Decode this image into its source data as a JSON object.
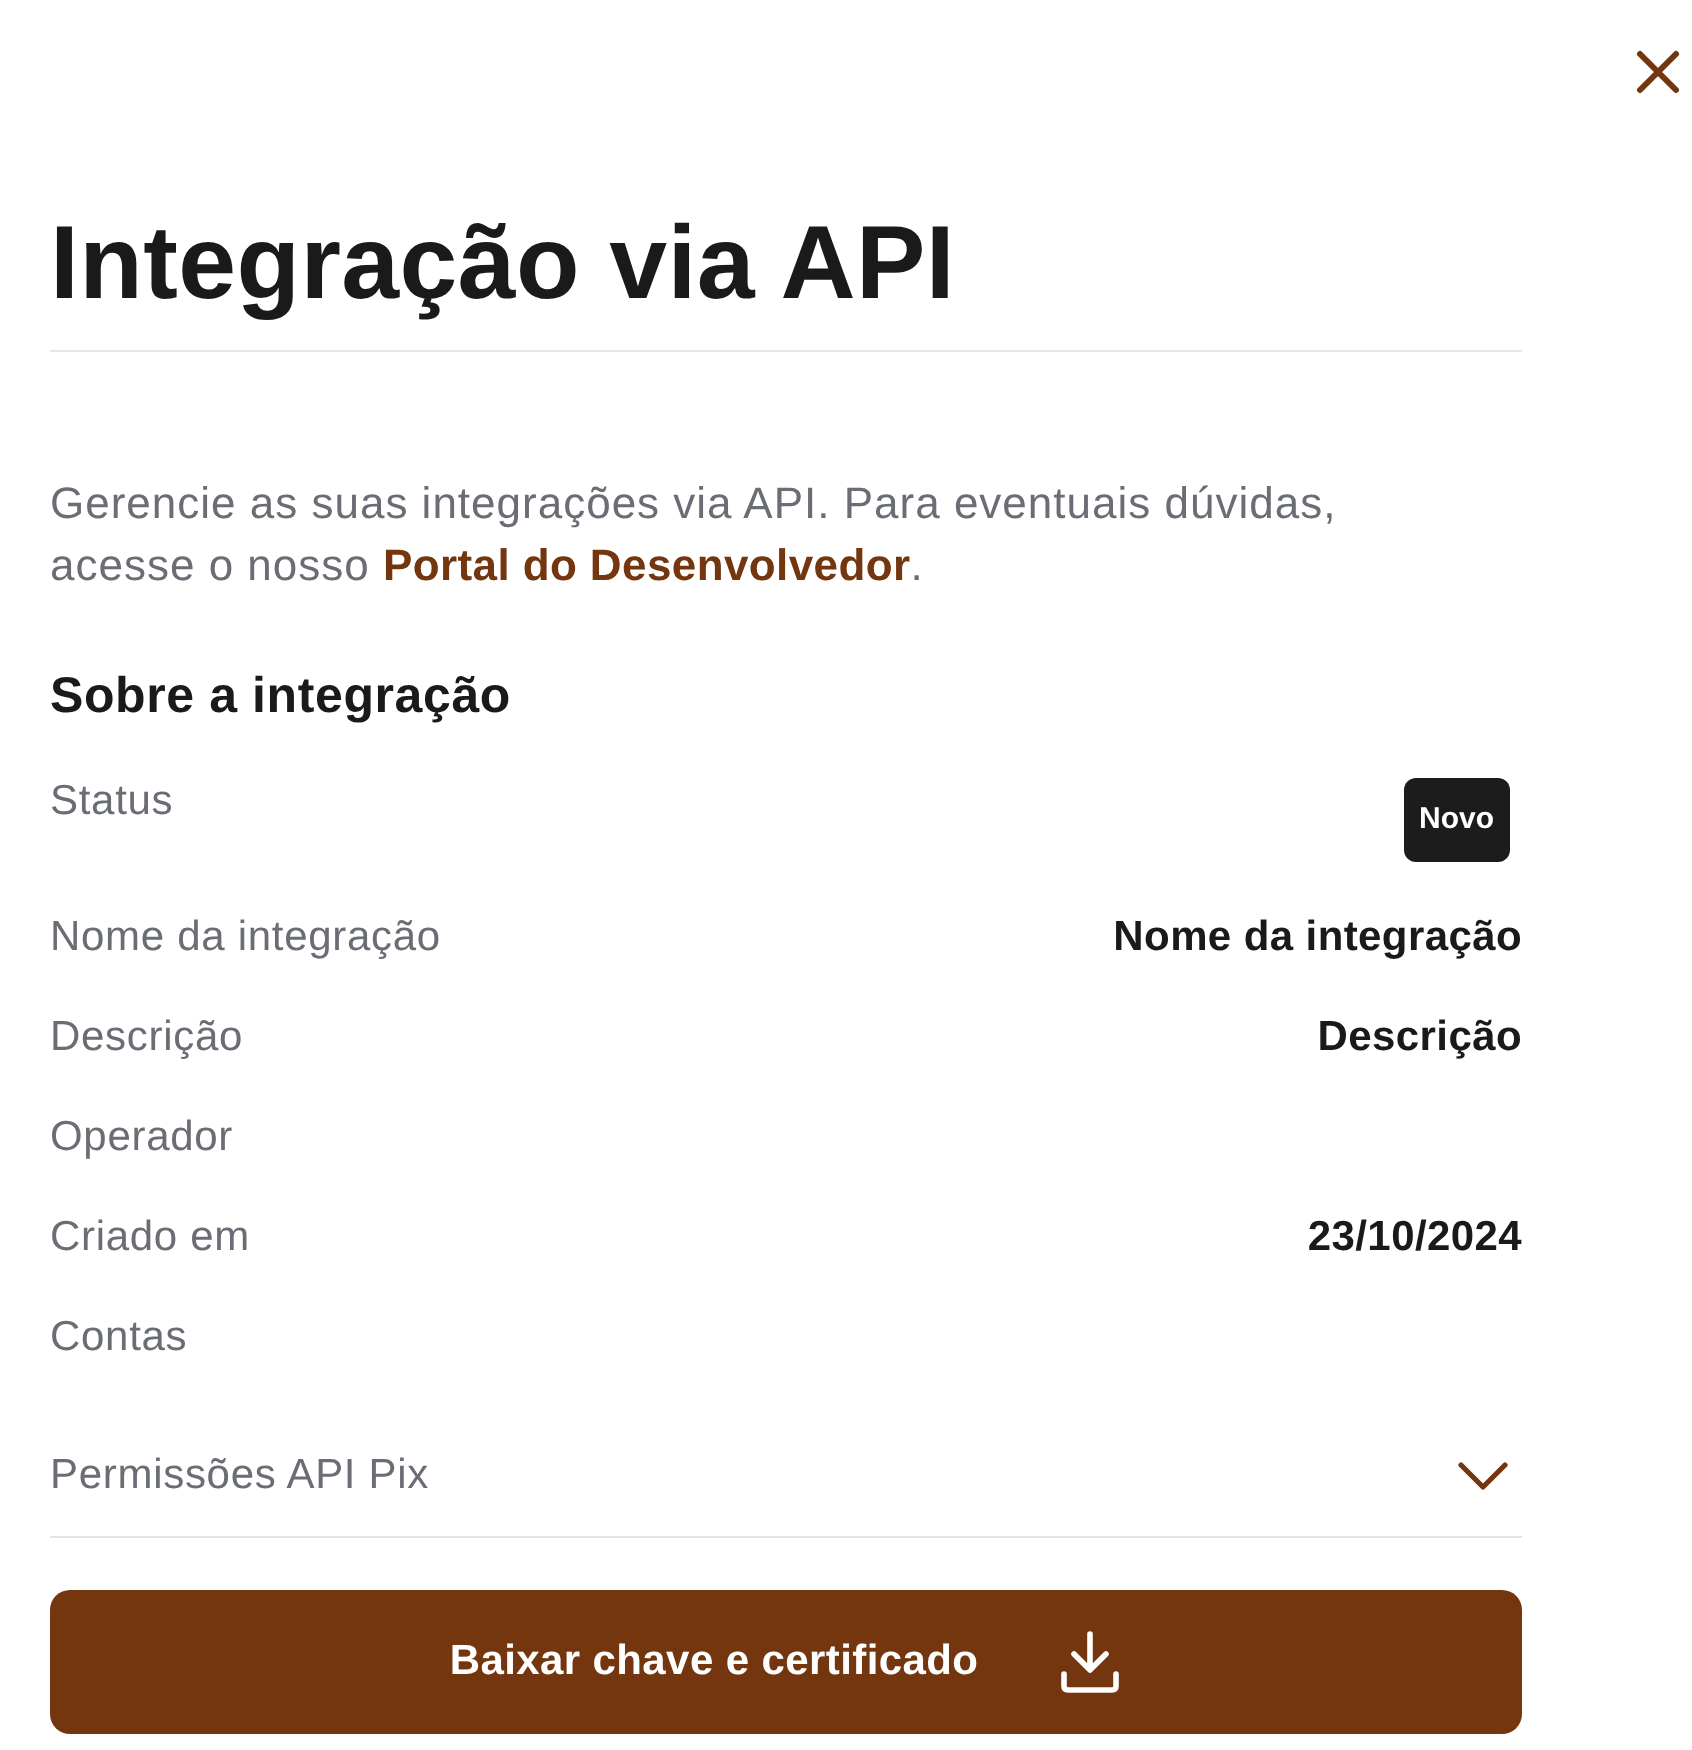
{
  "header": {
    "title": "Integração via API"
  },
  "intro": {
    "text_before": "Gerencie as suas integrações via API. Para eventuais dúvidas, acesse o nosso ",
    "link": "Portal do Desenvolvedor",
    "text_after": "."
  },
  "section": {
    "title": "Sobre a integração",
    "rows": [
      {
        "label": "Status",
        "kind": "badge",
        "value": "Novo"
      },
      {
        "label": "Nome da integração",
        "kind": "text",
        "value": "Nome da integração"
      },
      {
        "label": "Descrição",
        "kind": "text",
        "value": "Descrição"
      },
      {
        "label": "Operador",
        "kind": "text"
      },
      {
        "label": "Criado em",
        "kind": "text",
        "value": "23/10/2024"
      },
      {
        "label": "Contas",
        "kind": "text"
      }
    ]
  },
  "accordion": {
    "label": "Permissões API Pix",
    "expanded": false
  },
  "primary_button": {
    "label": "Baixar chave e certificado"
  }
}
